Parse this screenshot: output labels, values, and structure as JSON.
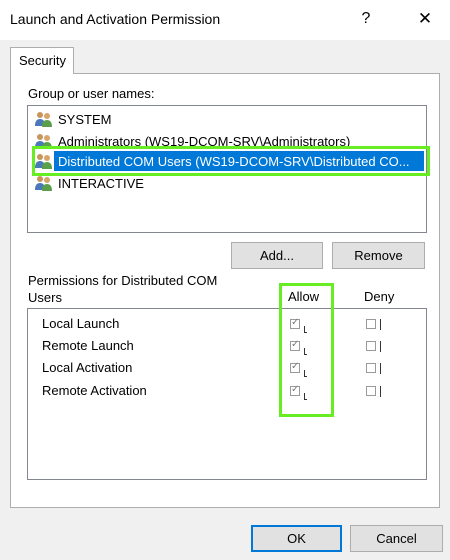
{
  "window": {
    "title": "Launch and Activation Permission",
    "help_glyph": "?",
    "close_glyph": "✕"
  },
  "tabs": [
    {
      "label": "Security",
      "selected": true
    }
  ],
  "group_label": "Group or user names:",
  "users": [
    {
      "name": "SYSTEM",
      "icon": "user-group-icon",
      "selected": false
    },
    {
      "name": "Administrators (WS19-DCOM-SRV\\Administrators)",
      "icon": "user-group-icon",
      "selected": false
    },
    {
      "name": "Distributed COM Users (WS19-DCOM-SRV\\Distributed CO...",
      "icon": "user-group-icon",
      "selected": true
    },
    {
      "name": "INTERACTIVE",
      "icon": "user-group-icon",
      "selected": false
    }
  ],
  "buttons": {
    "add": "Add...",
    "remove": "Remove",
    "ok": "OK",
    "cancel": "Cancel"
  },
  "permissions": {
    "label": "Permissions for Distributed COM Users",
    "col_allow": "Allow",
    "col_deny": "Deny",
    "rows": [
      {
        "name": "Local Launch",
        "allow": true,
        "deny": false
      },
      {
        "name": "Remote Launch",
        "allow": true,
        "deny": false
      },
      {
        "name": "Local Activation",
        "allow": true,
        "deny": false
      },
      {
        "name": "Remote Activation",
        "allow": true,
        "deny": false
      }
    ]
  },
  "colors": {
    "selection": "#0078d7",
    "highlight_box": "#66ee22",
    "face": "#f0f0f0"
  }
}
